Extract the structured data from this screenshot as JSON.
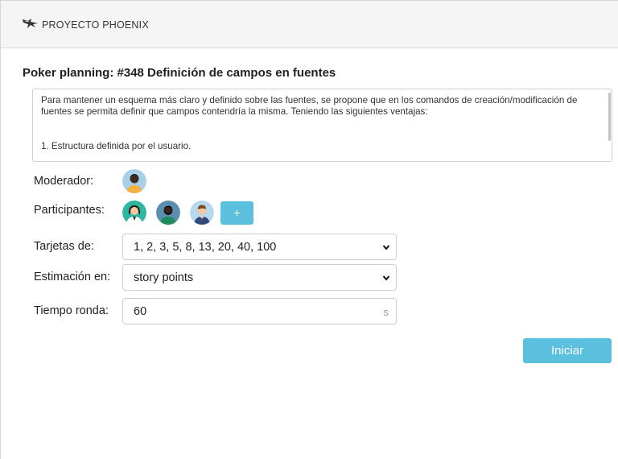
{
  "header": {
    "brand": "PROYECTO PHOENIX",
    "logo_icon": "phoenix-bird-icon"
  },
  "page": {
    "title": "Poker planning: #348 Definición de campos en fuentes"
  },
  "description": {
    "text": "Para mantener un esquema más claro y definido sobre las fuentes, se propone que en los comandos de creación/modificación de fuentes se permita definir que campos contendría la misma. Teniendo las siguientes ventajas:",
    "list": [
      "1. Estructura definida por el usuario."
    ]
  },
  "moderator": {
    "label": "Moderador:",
    "avatar_icon": "user-avatar-icon"
  },
  "participants": {
    "label": "Participantes:",
    "add_label": "+",
    "avatars": [
      "woman-avatar-icon",
      "man-avatar-icon",
      "businessman-avatar-icon"
    ]
  },
  "cards": {
    "label": "Tarjetas de:",
    "value": "1, 2, 3, 5, 8, 13, 20, 40, 100"
  },
  "estimation": {
    "label": "Estimación en:",
    "value": "story points"
  },
  "round_time": {
    "label": "Tiempo ronda:",
    "value": "60",
    "unit": "s"
  },
  "actions": {
    "start_label": "Iniciar"
  },
  "colors": {
    "accent": "#5bc0de",
    "header_bg": "#f5f5f5"
  }
}
